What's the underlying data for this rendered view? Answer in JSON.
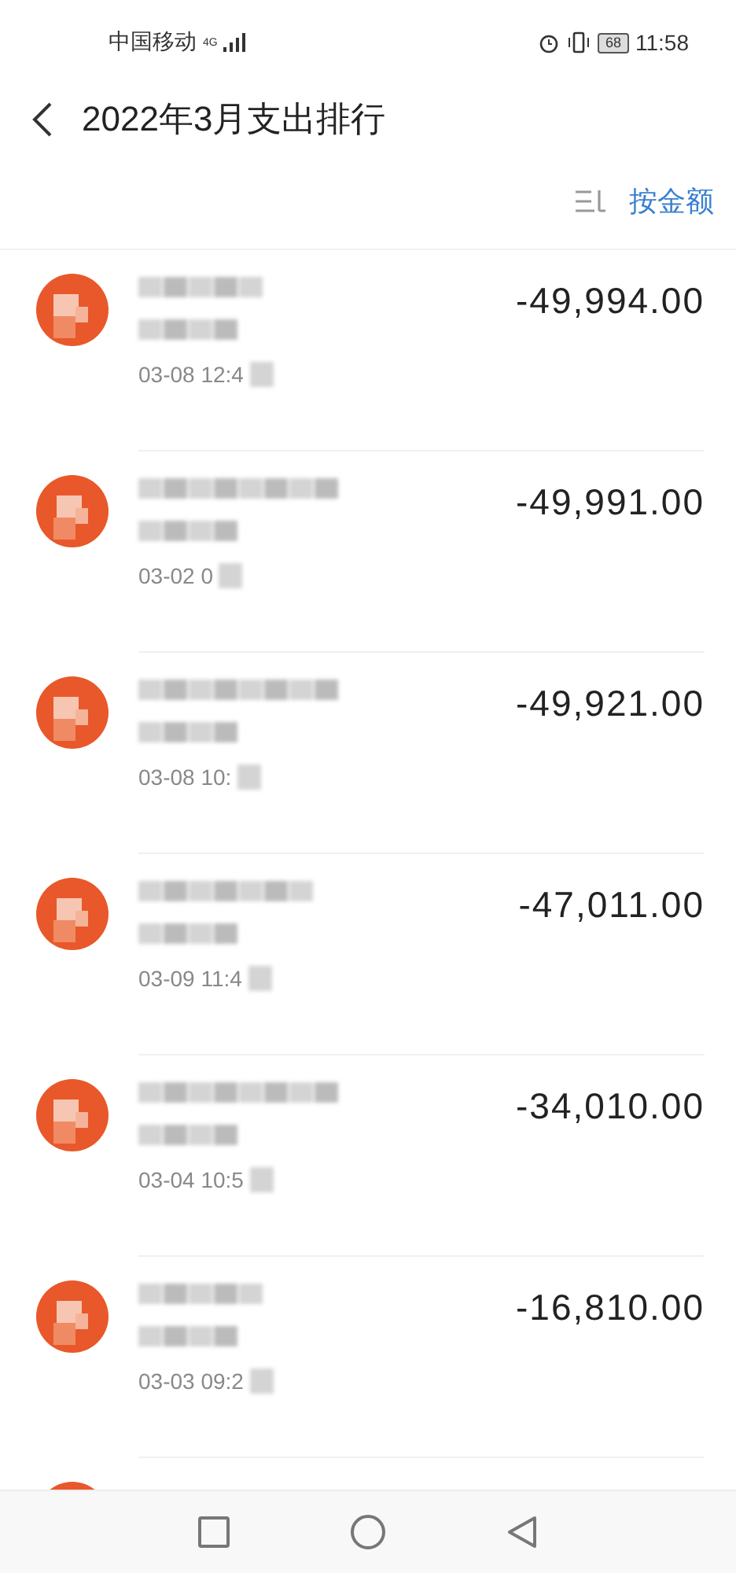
{
  "status_bar": {
    "carrier": "中国移动",
    "network": "4G",
    "battery": "68",
    "time": "11:58"
  },
  "header": {
    "title": "2022年3月支出排行"
  },
  "sort": {
    "label": "按金额"
  },
  "transactions": [
    {
      "amount": "-49,994.00",
      "time": "03-08  12:4"
    },
    {
      "amount": "-49,991.00",
      "time": "03-02  0"
    },
    {
      "amount": "-49,921.00",
      "time": "03-08  10:"
    },
    {
      "amount": "-47,011.00",
      "time": "03-09  11:4"
    },
    {
      "amount": "-34,010.00",
      "time": "03-04  10:5"
    },
    {
      "amount": "-16,810.00",
      "time": "03-03  09:2"
    }
  ]
}
